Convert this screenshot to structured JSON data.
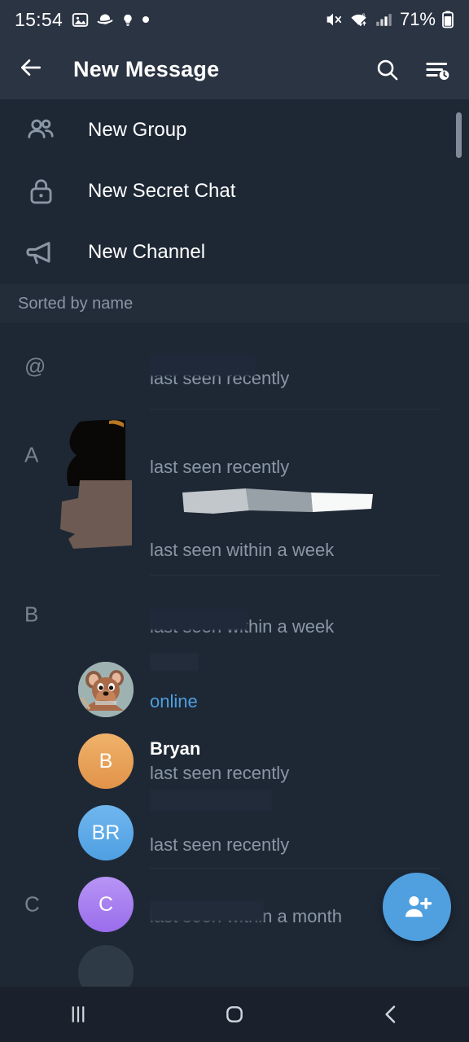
{
  "status_bar": {
    "time": "15:54",
    "battery_percent": "71%",
    "left_icons": [
      "image-icon",
      "planet-icon",
      "lightbulb-icon",
      "dot-icon"
    ],
    "right_icons": [
      "mute-icon",
      "wifi-icon",
      "cellular-signal-icon",
      "battery-icon"
    ]
  },
  "app_bar": {
    "title": "New Message",
    "back_icon": "back-arrow-icon",
    "search_icon": "search-icon",
    "sort_icon": "sort-by-time-icon"
  },
  "actions": [
    {
      "label": "New Group",
      "icon": "people-icon"
    },
    {
      "label": "New Secret Chat",
      "icon": "lock-icon"
    },
    {
      "label": "New Channel",
      "icon": "megaphone-icon"
    }
  ],
  "section_header": {
    "label": "Sorted by name"
  },
  "contacts": [
    {
      "section": "@",
      "name": "",
      "status": "last seen recently",
      "status_type": "offline",
      "avatar": {
        "type": "none",
        "initials": "",
        "color": ""
      },
      "redacted": true
    },
    {
      "section": "A",
      "name": "",
      "status": "last seen recently",
      "status_type": "offline",
      "avatar": {
        "type": "redacted-dark",
        "initials": "",
        "color": "#0a0806"
      },
      "redacted": true
    },
    {
      "section": "",
      "name": "",
      "status": "last seen within a week",
      "status_type": "offline",
      "avatar": {
        "type": "redacted-brown",
        "initials": "",
        "color": "#6d5a52"
      },
      "redacted": true
    },
    {
      "section": "B",
      "name": "",
      "status": "last seen within a week",
      "status_type": "offline",
      "avatar": {
        "type": "none",
        "initials": "",
        "color": ""
      },
      "redacted": true
    },
    {
      "section": "",
      "name": "",
      "status": "online",
      "status_type": "online",
      "avatar": {
        "type": "photo-mouse",
        "initials": "",
        "color": "#9fb2b3"
      },
      "redacted": true
    },
    {
      "section": "",
      "name": "Bryan",
      "status": "last seen recently",
      "status_type": "offline",
      "avatar": {
        "type": "initials",
        "initials": "B",
        "color": "#e8a55a"
      },
      "redacted": false
    },
    {
      "section": "",
      "name": "",
      "status": "last seen recently",
      "status_type": "offline",
      "avatar": {
        "type": "initials",
        "initials": "BR",
        "color": "#5aaae8"
      },
      "redacted": true
    },
    {
      "section": "C",
      "name": "",
      "status": "last seen within a month",
      "status_type": "offline",
      "avatar": {
        "type": "initials",
        "initials": "C",
        "color": "#a684ef"
      },
      "redacted": true
    }
  ],
  "fab": {
    "icon": "add-person-icon",
    "color": "#50a0df"
  },
  "nav_bar": {
    "recents_icon": "recent-apps-icon",
    "home_icon": "home-icon",
    "back_icon": "nav-back-icon"
  },
  "colors": {
    "app_bar_bg": "#2b3443",
    "page_bg": "#1e2835",
    "section_header_bg": "#232c39",
    "accent": "#4d9fe0",
    "muted_text": "#8b97a5"
  }
}
